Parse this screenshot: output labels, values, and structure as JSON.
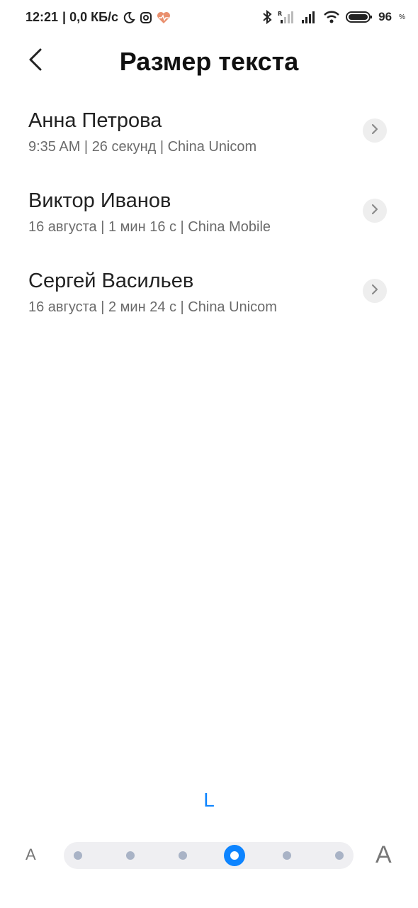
{
  "status_bar": {
    "time": "12:21",
    "speed": "| 0,0 КБ/с",
    "battery_percent": "96",
    "percent_sign": "%"
  },
  "header": {
    "title": "Размер текста"
  },
  "calls": [
    {
      "name": "Анна Петрова",
      "meta": "9:35 AM | 26 секунд | China Unicom"
    },
    {
      "name": "Виктор Иванов",
      "meta": "16 августа | 1 мин 16 с | China Mobile"
    },
    {
      "name": "Сергей Васильев",
      "meta": "16 августа | 2 мин 24 с | China Unicom"
    }
  ],
  "text_size": {
    "current_label": "L",
    "small_label": "A",
    "large_label": "A",
    "steps": 6,
    "selected_step": 4
  },
  "colors": {
    "accent": "#0d84ff",
    "dot": "#a9b3c6",
    "track": "#efeff2"
  }
}
